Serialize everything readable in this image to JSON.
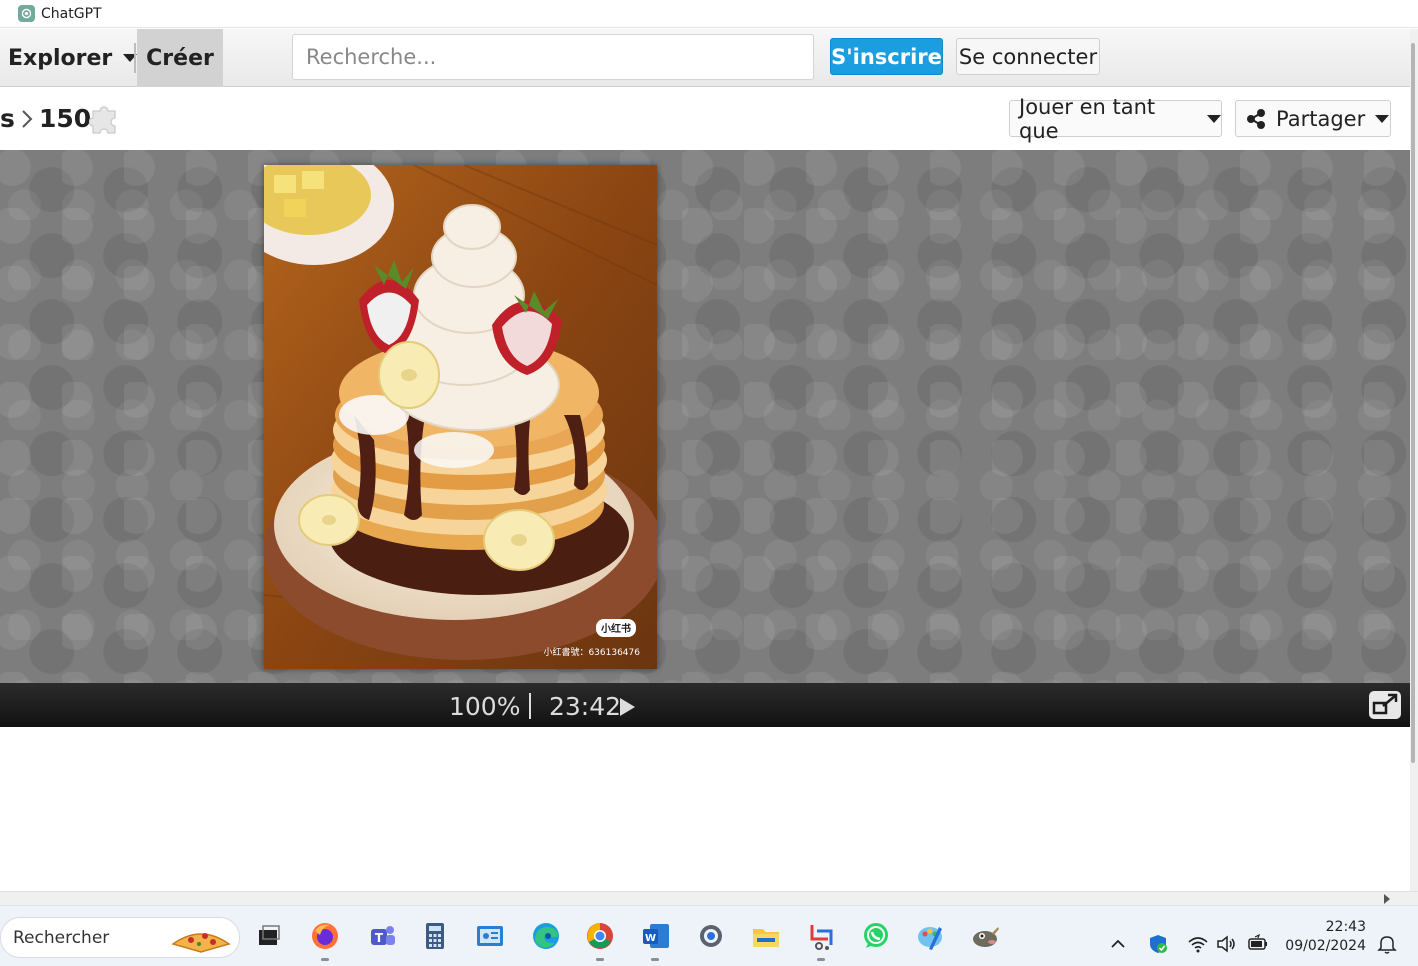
{
  "window": {
    "title": "ChatGPT"
  },
  "nav": {
    "explore_label": "Explorer",
    "create_label": "Créer",
    "search_placeholder": "Recherche...",
    "signup_label": "S'inscrire",
    "login_label": "Se connecter"
  },
  "breadcrumb": {
    "previous_fragment": "s",
    "piece_count": "150"
  },
  "toolbar": {
    "play_as_label": "Jouer en tant que",
    "share_label": "Partager"
  },
  "puzzle": {
    "watermark_brand": "小红书",
    "watermark_id": "小红書號：636136476"
  },
  "status": {
    "zoom": "100%",
    "timer": "23:42"
  },
  "taskbar": {
    "search_label": "Rechercher",
    "apps": [
      "task-view-icon",
      "firefox-icon",
      "teams-icon",
      "calculator-icon",
      "control-panel-icon",
      "edge-icon",
      "chrome-icon",
      "word-icon",
      "settings-icon",
      "file-explorer-icon",
      "snipping-tool-icon",
      "whatsapp-icon",
      "paint-icon",
      "gimp-icon"
    ],
    "clock_time": "22:43",
    "clock_date": "09/02/2024"
  },
  "colors": {
    "accent": "#1a9ee0",
    "stage_bg": "#7d7d7d",
    "statusbar_bg": "#1c1c1c"
  }
}
